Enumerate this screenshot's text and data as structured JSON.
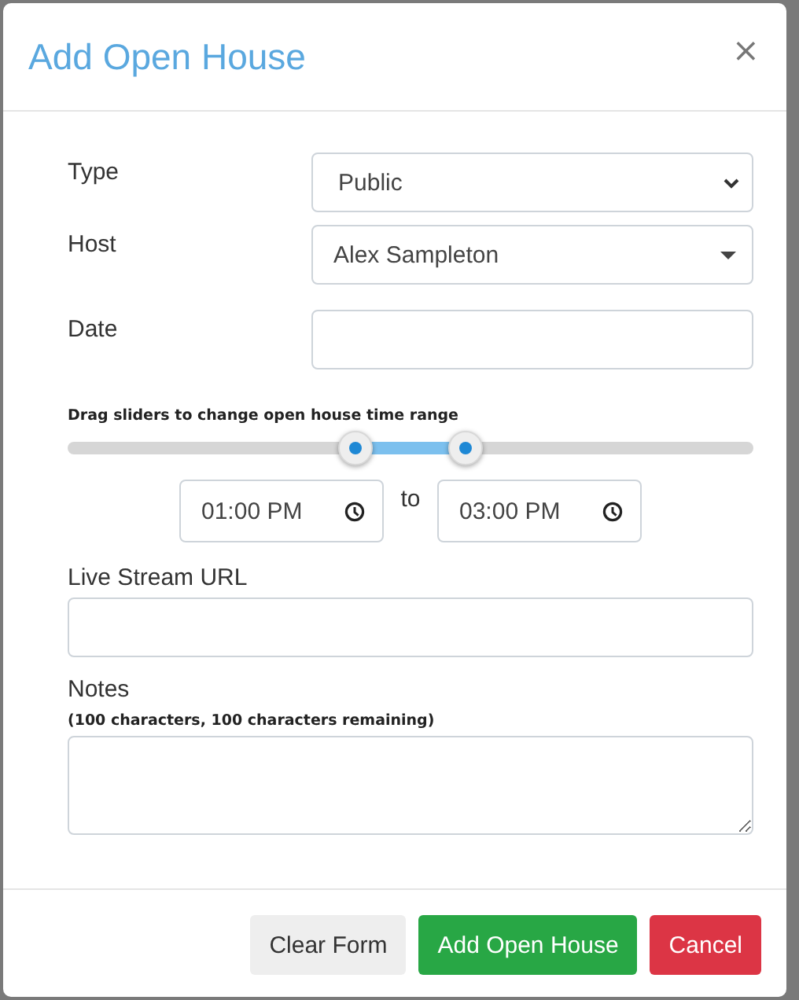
{
  "dialog": {
    "title": "Add Open House",
    "close": "×"
  },
  "fields": [
    {
      "kind": "select",
      "label": "Type",
      "value": "Public"
    },
    {
      "kind": "dropdown",
      "label": "Host",
      "value": "Alex Sampleton"
    },
    {
      "kind": "text",
      "label": "Date"
    }
  ],
  "time_range": {
    "hint": "Drag sliders to change open house time range",
    "start": {
      "level": 0.42
    },
    "end": {
      "level": 0.58
    },
    "from": "01:00 PM",
    "separator": "to",
    "until": "03:00 PM"
  },
  "stream": {
    "label": "Live Stream URL"
  },
  "notes": {
    "label": "Notes",
    "hint": "(100 characters, 100 characters remaining)"
  },
  "buttons": [
    {
      "kind": "secondary",
      "label": "Clear Form"
    },
    {
      "kind": "success",
      "label": "Add Open House"
    },
    {
      "kind": "danger",
      "label": "Cancel"
    }
  ]
}
